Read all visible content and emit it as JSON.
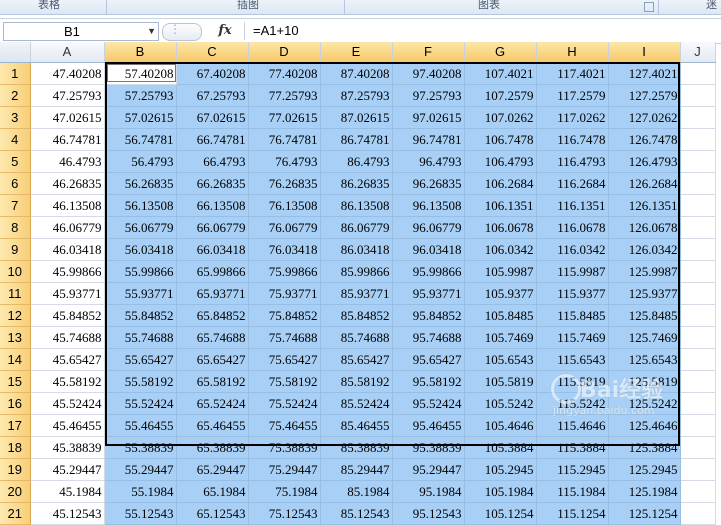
{
  "ribbon": {
    "groups": [
      "表格",
      "插图",
      "图表",
      "迷"
    ]
  },
  "formula_bar": {
    "name_box": "B1",
    "fx_label": "fx",
    "formula": "=A1+10"
  },
  "columns": [
    "A",
    "B",
    "C",
    "D",
    "E",
    "F",
    "G",
    "H",
    "I",
    "J"
  ],
  "selection": {
    "start": "B1",
    "end": "I21",
    "active_cell": "B1"
  },
  "watermark": {
    "text": "Bai经验",
    "sub": "jingyan.baidu.com"
  },
  "rows": [
    {
      "n": "1",
      "cells": [
        "47.40208",
        "57.40208",
        "67.40208",
        "77.40208",
        "87.40208",
        "97.40208",
        "107.4021",
        "117.4021",
        "127.4021"
      ]
    },
    {
      "n": "2",
      "cells": [
        "47.25793",
        "57.25793",
        "67.25793",
        "77.25793",
        "87.25793",
        "97.25793",
        "107.2579",
        "117.2579",
        "127.2579"
      ]
    },
    {
      "n": "3",
      "cells": [
        "47.02615",
        "57.02615",
        "67.02615",
        "77.02615",
        "87.02615",
        "97.02615",
        "107.0262",
        "117.0262",
        "127.0262"
      ]
    },
    {
      "n": "4",
      "cells": [
        "46.74781",
        "56.74781",
        "66.74781",
        "76.74781",
        "86.74781",
        "96.74781",
        "106.7478",
        "116.7478",
        "126.7478"
      ]
    },
    {
      "n": "5",
      "cells": [
        "46.4793",
        "56.4793",
        "66.4793",
        "76.4793",
        "86.4793",
        "96.4793",
        "106.4793",
        "116.4793",
        "126.4793"
      ]
    },
    {
      "n": "6",
      "cells": [
        "46.26835",
        "56.26835",
        "66.26835",
        "76.26835",
        "86.26835",
        "96.26835",
        "106.2684",
        "116.2684",
        "126.2684"
      ]
    },
    {
      "n": "7",
      "cells": [
        "46.13508",
        "56.13508",
        "66.13508",
        "76.13508",
        "86.13508",
        "96.13508",
        "106.1351",
        "116.1351",
        "126.1351"
      ]
    },
    {
      "n": "8",
      "cells": [
        "46.06779",
        "56.06779",
        "66.06779",
        "76.06779",
        "86.06779",
        "96.06779",
        "106.0678",
        "116.0678",
        "126.0678"
      ]
    },
    {
      "n": "9",
      "cells": [
        "46.03418",
        "56.03418",
        "66.03418",
        "76.03418",
        "86.03418",
        "96.03418",
        "106.0342",
        "116.0342",
        "126.0342"
      ]
    },
    {
      "n": "10",
      "cells": [
        "45.99866",
        "55.99866",
        "65.99866",
        "75.99866",
        "85.99866",
        "95.99866",
        "105.9987",
        "115.9987",
        "125.9987"
      ]
    },
    {
      "n": "11",
      "cells": [
        "45.93771",
        "55.93771",
        "65.93771",
        "75.93771",
        "85.93771",
        "95.93771",
        "105.9377",
        "115.9377",
        "125.9377"
      ]
    },
    {
      "n": "12",
      "cells": [
        "45.84852",
        "55.84852",
        "65.84852",
        "75.84852",
        "85.84852",
        "95.84852",
        "105.8485",
        "115.8485",
        "125.8485"
      ]
    },
    {
      "n": "13",
      "cells": [
        "45.74688",
        "55.74688",
        "65.74688",
        "75.74688",
        "85.74688",
        "95.74688",
        "105.7469",
        "115.7469",
        "125.7469"
      ]
    },
    {
      "n": "14",
      "cells": [
        "45.65427",
        "55.65427",
        "65.65427",
        "75.65427",
        "85.65427",
        "95.65427",
        "105.6543",
        "115.6543",
        "125.6543"
      ]
    },
    {
      "n": "15",
      "cells": [
        "45.58192",
        "55.58192",
        "65.58192",
        "75.58192",
        "85.58192",
        "95.58192",
        "105.5819",
        "115.5819",
        "125.5819"
      ]
    },
    {
      "n": "16",
      "cells": [
        "45.52424",
        "55.52424",
        "65.52424",
        "75.52424",
        "85.52424",
        "95.52424",
        "105.5242",
        "115.5242",
        "125.5242"
      ]
    },
    {
      "n": "17",
      "cells": [
        "45.46455",
        "55.46455",
        "65.46455",
        "75.46455",
        "85.46455",
        "95.46455",
        "105.4646",
        "115.4646",
        "125.4646"
      ]
    },
    {
      "n": "18",
      "cells": [
        "45.38839",
        "55.38839",
        "65.38839",
        "75.38839",
        "85.38839",
        "95.38839",
        "105.3884",
        "115.3884",
        "125.3884"
      ]
    },
    {
      "n": "19",
      "cells": [
        "45.29447",
        "55.29447",
        "65.29447",
        "75.29447",
        "85.29447",
        "95.29447",
        "105.2945",
        "115.2945",
        "125.2945"
      ]
    },
    {
      "n": "20",
      "cells": [
        "45.1984",
        "55.1984",
        "65.1984",
        "75.1984",
        "85.1984",
        "95.1984",
        "105.1984",
        "115.1984",
        "125.1984"
      ]
    },
    {
      "n": "21",
      "cells": [
        "45.12543",
        "55.12543",
        "65.12543",
        "75.12543",
        "85.12543",
        "95.12543",
        "105.1254",
        "115.1254",
        "125.1254"
      ]
    }
  ]
}
